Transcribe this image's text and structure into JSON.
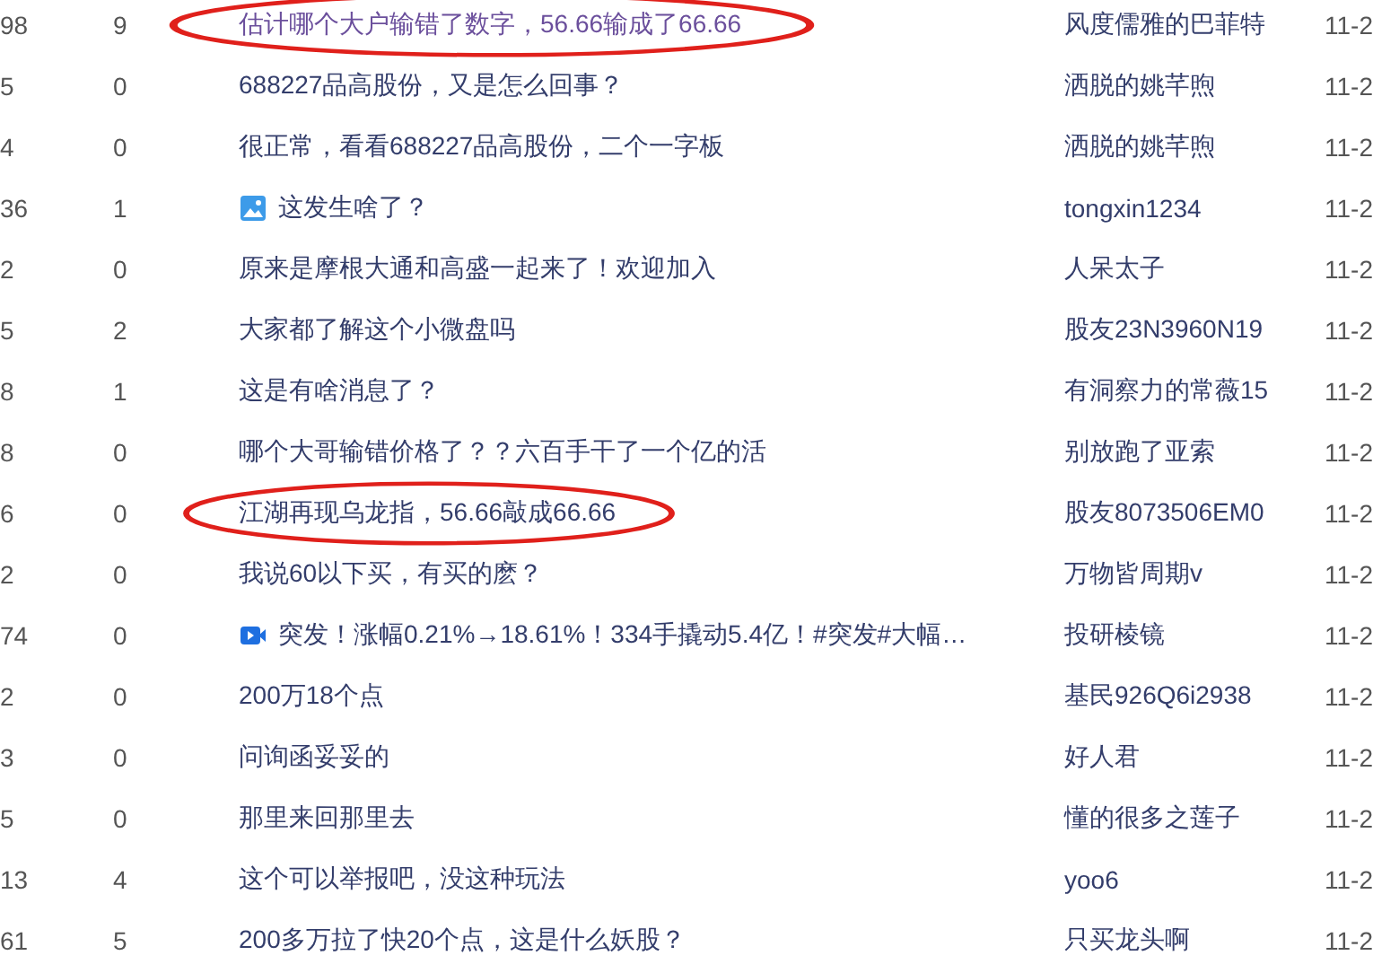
{
  "posts": [
    {
      "reads": "98",
      "replies": "9",
      "kind": "text",
      "title": "估计哪个大户输错了数字，56.66输成了66.66",
      "visited": true,
      "circled": true,
      "author": "风度儒雅的巴菲特",
      "date": "11-2"
    },
    {
      "reads": "5",
      "replies": "0",
      "kind": "text",
      "title": "688227品高股份，又是怎么回事？",
      "visited": false,
      "circled": false,
      "author": "洒脱的姚芊煦",
      "date": "11-2"
    },
    {
      "reads": "4",
      "replies": "0",
      "kind": "text",
      "title": "很正常，看看688227品高股份，二个一字板",
      "visited": false,
      "circled": false,
      "author": "洒脱的姚芊煦",
      "date": "11-2"
    },
    {
      "reads": "36",
      "replies": "1",
      "kind": "image",
      "title": "这发生啥了？",
      "visited": false,
      "circled": false,
      "author": "tongxin1234",
      "date": "11-2"
    },
    {
      "reads": "2",
      "replies": "0",
      "kind": "text",
      "title": "原来是摩根大通和高盛一起来了！欢迎加入",
      "visited": false,
      "circled": false,
      "author": "人呆太子",
      "date": "11-2"
    },
    {
      "reads": "5",
      "replies": "2",
      "kind": "text",
      "title": "大家都了解这个小微盘吗",
      "visited": false,
      "circled": false,
      "author": "股友23N3960N19",
      "date": "11-2"
    },
    {
      "reads": "8",
      "replies": "1",
      "kind": "text",
      "title": "这是有啥消息了？",
      "visited": false,
      "circled": false,
      "author": "有洞察力的常薇15",
      "date": "11-2"
    },
    {
      "reads": "8",
      "replies": "0",
      "kind": "text",
      "title": "哪个大哥输错价格了？？六百手干了一个亿的活",
      "visited": false,
      "circled": false,
      "author": "别放跑了亚索",
      "date": "11-2"
    },
    {
      "reads": "6",
      "replies": "0",
      "kind": "text",
      "title": "江湖再现乌龙指，56.66敲成66.66",
      "visited": false,
      "circled": true,
      "author": "股友8073506EM0",
      "date": "11-2"
    },
    {
      "reads": "2",
      "replies": "0",
      "kind": "text",
      "title": "我说60以下买，有买的麽？",
      "visited": false,
      "circled": false,
      "author": "万物皆周期v",
      "date": "11-2"
    },
    {
      "reads": "74",
      "replies": "0",
      "kind": "video",
      "title": "突发！涨幅0.21%→18.61%！334手撬动5.4亿！#突发#大幅…",
      "visited": false,
      "circled": false,
      "author": "投研棱镜",
      "date": "11-2"
    },
    {
      "reads": "2",
      "replies": "0",
      "kind": "text",
      "title": "200万18个点",
      "visited": false,
      "circled": false,
      "author": "基民926Q6i2938",
      "date": "11-2"
    },
    {
      "reads": "3",
      "replies": "0",
      "kind": "text",
      "title": "问询函妥妥的",
      "visited": false,
      "circled": false,
      "author": "好人君",
      "date": "11-2"
    },
    {
      "reads": "5",
      "replies": "0",
      "kind": "text",
      "title": "那里来回那里去",
      "visited": false,
      "circled": false,
      "author": "懂的很多之莲子",
      "date": "11-2"
    },
    {
      "reads": "13",
      "replies": "4",
      "kind": "text",
      "title": "这个可以举报吧，没这种玩法",
      "visited": false,
      "circled": false,
      "author": "yoo6",
      "date": "11-2"
    },
    {
      "reads": "61",
      "replies": "5",
      "kind": "text",
      "title": "200多万拉了快20个点，这是什么妖股？",
      "visited": false,
      "circled": false,
      "author": "只买龙头啊",
      "date": "11-2"
    }
  ]
}
